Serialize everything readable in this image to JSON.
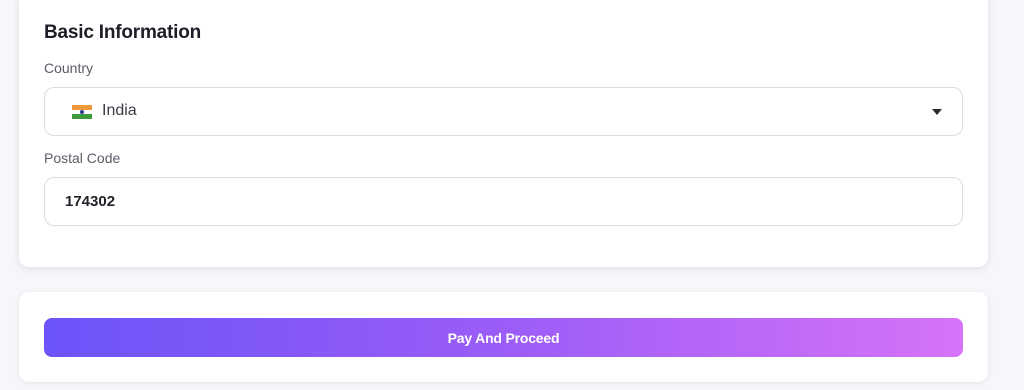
{
  "basic_info": {
    "title": "Basic Information",
    "country": {
      "label": "Country",
      "selected": "India",
      "flag_icon": "india-flag-icon",
      "caret_icon": "caret-down-icon"
    },
    "postal_code": {
      "label": "Postal Code",
      "value": "174302"
    }
  },
  "payment": {
    "button_label": "Pay And Proceed",
    "gradient_start": "#6b54f9",
    "gradient_end": "#d673f8"
  }
}
